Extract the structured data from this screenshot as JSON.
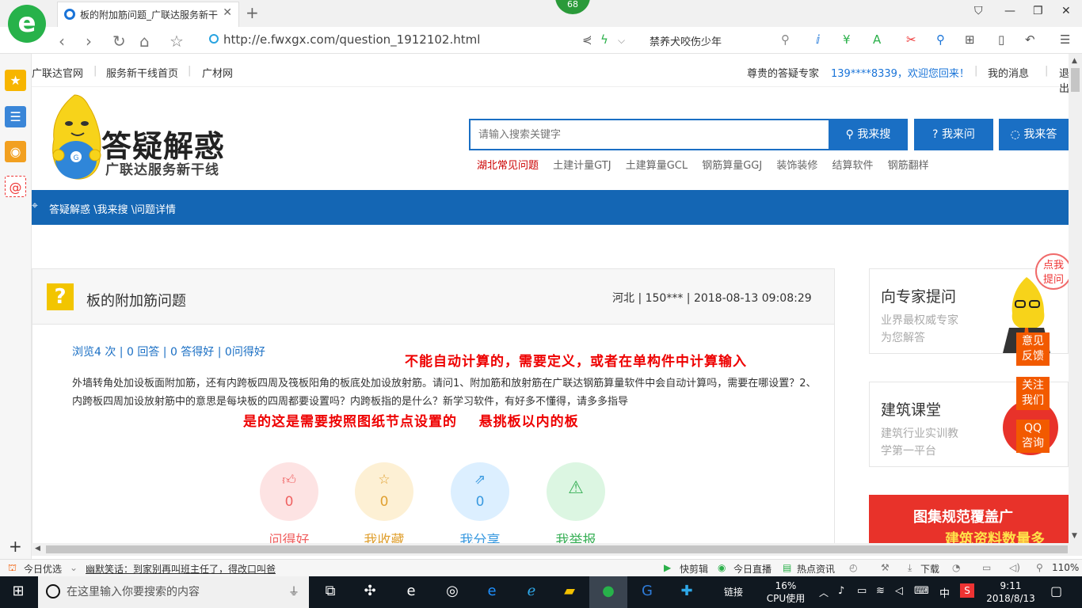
{
  "browser": {
    "tab_title": "板的附加筋问题_广联达服务新干",
    "badge": "68",
    "url": "http://e.fwxgx.com/question_1912102.html",
    "right_search_text": "禁养犬咬伤少年"
  },
  "topnav": {
    "links": [
      "广联达官网",
      "服务新干线首页",
      "广材网"
    ],
    "expert_label": "尊贵的答疑专家",
    "welcome": "139****8339，欢迎您回来！",
    "messages": "我的消息",
    "logout": "退出"
  },
  "logo": {
    "title": "答疑解惑",
    "subtitle": "广联达服务新干线",
    "mascot_letter": "G"
  },
  "search": {
    "placeholder": "请输入搜索关键字",
    "btn_search": "我来搜",
    "btn_ask": "我来问",
    "btn_answer": "我来答",
    "hot_tags": [
      "湖北常见问题",
      "土建计量GTJ",
      "土建算量GCL",
      "钢筋算量GGJ",
      "装饰装修",
      "结算软件",
      "钢筋翻样"
    ]
  },
  "breadcrumb": "答疑解惑 \\我来搜 \\问题详情",
  "question": {
    "icon": "?",
    "title": "板的附加筋问题",
    "meta": "河北 | 150*** | 2018-08-13 09:08:29",
    "stats": "浏览4 次 | 0 回答 | 0 答得好 | 0问得好",
    "body": "外墙转角处加设板面附加筋，还有内跨板四周及筏板阳角的板底处加设放射筋。请问1、附加筋和放射筋在广联达钢筋算量软件中会自动计算吗，需要在哪设置？2、内跨板四周加设放射筋中的意思是每块板的四周都要设置吗？内跨板指的是什么？新学习软件，有好多不懂得，请多多指导",
    "annotation_1": "不能自动计算的，需要定义，或者在单构件中计算输入",
    "annotation_2": "是的这是需要按照图纸节点设置的    悬挑板以内的板"
  },
  "actions": [
    {
      "label": "问得好",
      "count": "0",
      "icon": "thumbs-up-icon",
      "color": "#f06262",
      "bg": "#fde3e3"
    },
    {
      "label": "我收藏",
      "count": "0",
      "icon": "star-icon",
      "color": "#e0a030",
      "bg": "#fdf0d4"
    },
    {
      "label": "我分享",
      "count": "0",
      "icon": "share-icon",
      "color": "#3a9ae0",
      "bg": "#dcefff"
    },
    {
      "label": "我举报",
      "count": "",
      "icon": "warning-icon",
      "color": "#3ab058",
      "bg": "#dcf6e2"
    }
  ],
  "right": {
    "card1_title": "向专家提问",
    "card1_sub": "业界最权威专家\n为您解答",
    "card2_title": "建筑课堂",
    "card2_sub": "建筑行业实训教\n学第一平台",
    "bubble": "点我\n提问",
    "float_btns": [
      "意见\n反馈",
      "关注\n我们",
      "QQ\n咨询"
    ],
    "banner_text1": "图集规范覆盖广",
    "banner_text2": "建筑资料数量多"
  },
  "statusbar": {
    "today": "今日优选",
    "news": "幽默笑话：到家别再叫班主任了，得改口叫爸",
    "quick": "快剪辑",
    "live": "今日直播",
    "hot": "热点资讯",
    "download": "下载",
    "zoom": "110%"
  },
  "taskbar": {
    "search_placeholder": "在这里输入你要搜索的内容",
    "links": "链接",
    "cpu_pct": "16%",
    "cpu_label": "CPU使用",
    "ime": "中",
    "time": "9:11",
    "date": "2018/8/13"
  }
}
